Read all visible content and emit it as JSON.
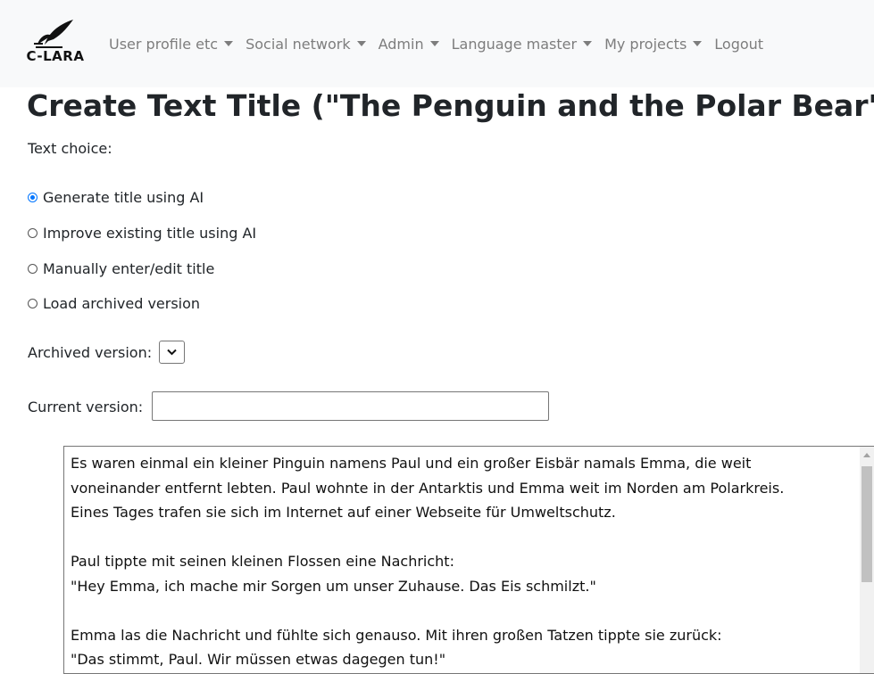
{
  "logo": {
    "text": "C-LARA"
  },
  "nav": {
    "items": [
      {
        "label": "User profile etc",
        "dropdown": true
      },
      {
        "label": "Social network",
        "dropdown": true
      },
      {
        "label": "Admin",
        "dropdown": true
      },
      {
        "label": "Language master",
        "dropdown": true
      },
      {
        "label": "My projects",
        "dropdown": true
      },
      {
        "label": "Logout",
        "dropdown": false
      }
    ]
  },
  "page": {
    "title": "Create Text Title (\"The Penguin and the Polar Bear\")",
    "text_choice_label": "Text choice:"
  },
  "options": [
    {
      "label": "Generate title using AI",
      "checked": true
    },
    {
      "label": "Improve existing title using AI",
      "checked": false
    },
    {
      "label": "Manually enter/edit title",
      "checked": false
    },
    {
      "label": "Load archived version",
      "checked": false
    }
  ],
  "archived": {
    "label": "Archived version:",
    "value": ""
  },
  "current": {
    "label": "Current version:",
    "value": ""
  },
  "textarea": {
    "lines": [
      "Es waren einmal ein kleiner Pinguin namens Paul und ein großer Eisbär namals Emma, die weit",
      "voneinander entfernt lebten. Paul wohnte in der Antarktis und Emma weit im Norden am Polarkreis.",
      "Eines Tages trafen sie sich im Internet auf einer Webseite für Umweltschutz.",
      "",
      "Paul tippte mit seinen kleinen Flossen eine Nachricht:",
      "\"Hey Emma, ich mache mir Sorgen um unser Zuhause. Das Eis schmilzt.\"",
      "",
      "Emma las die Nachricht und fühlte sich genauso. Mit ihren großen Tatzen tippte sie zurück:",
      "\"Das stimmt, Paul. Wir müssen etwas dagegen tun!\""
    ]
  },
  "colors": {
    "nav_bg": "#f8f9fa",
    "nav_text": "#7d7d7d",
    "radio_accent": "#0075ff"
  }
}
